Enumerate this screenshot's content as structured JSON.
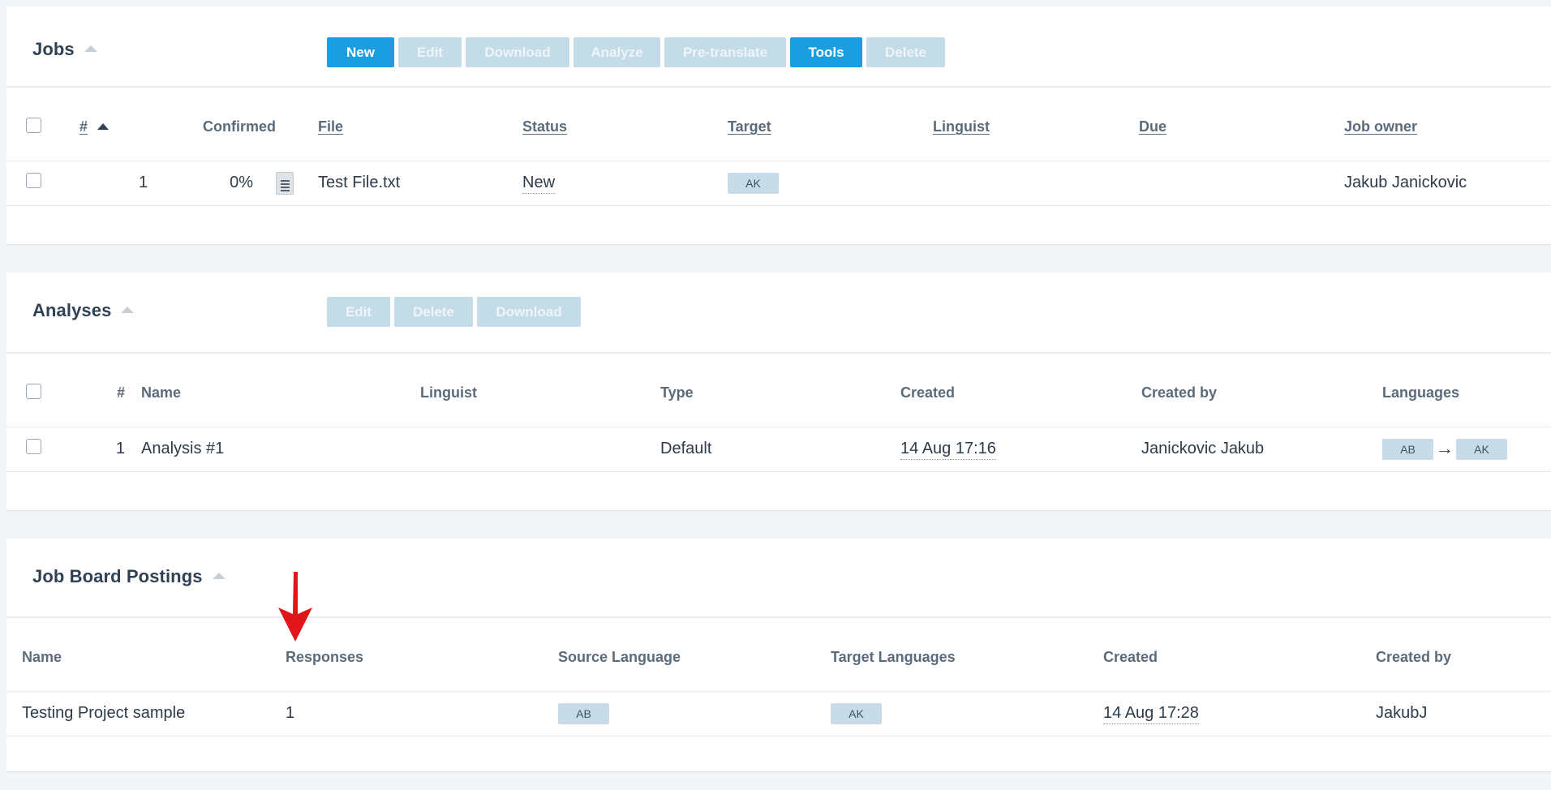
{
  "jobs": {
    "title": "Jobs",
    "toolbar": [
      {
        "label": "New",
        "state": "active"
      },
      {
        "label": "Edit",
        "state": "muted"
      },
      {
        "label": "Download",
        "state": "muted"
      },
      {
        "label": "Analyze",
        "state": "muted"
      },
      {
        "label": "Pre-translate",
        "state": "muted"
      },
      {
        "label": "Tools",
        "state": "active"
      },
      {
        "label": "Delete",
        "state": "muted"
      }
    ],
    "columns": {
      "num": "#",
      "confirmed": "Confirmed",
      "file": "File",
      "status": "Status",
      "target": "Target",
      "linguist": "Linguist",
      "due": "Due",
      "owner": "Job owner"
    },
    "rows": [
      {
        "num": "1",
        "confirmed": "0%",
        "file": "Test File.txt",
        "status": "New",
        "target": "AK",
        "linguist": "",
        "due": "",
        "owner": "Jakub Janickovic"
      }
    ]
  },
  "analyses": {
    "title": "Analyses",
    "toolbar": [
      {
        "label": "Edit",
        "state": "muted"
      },
      {
        "label": "Delete",
        "state": "muted"
      },
      {
        "label": "Download",
        "state": "muted"
      }
    ],
    "columns": {
      "num": "#",
      "name": "Name",
      "linguist": "Linguist",
      "type": "Type",
      "created": "Created",
      "created_by": "Created by",
      "languages": "Languages"
    },
    "rows": [
      {
        "num": "1",
        "name": "Analysis #1",
        "linguist": "",
        "type": "Default",
        "created": "14 Aug 17:16",
        "created_by": "Janickovic Jakub",
        "source_lang": "AB",
        "arrow": "→",
        "target_lang": "AK"
      }
    ]
  },
  "postings": {
    "title": "Job Board Postings",
    "columns": {
      "name": "Name",
      "responses": "Responses",
      "source_language": "Source Language",
      "target_languages": "Target Languages",
      "created": "Created",
      "created_by": "Created by"
    },
    "rows": [
      {
        "name": "Testing Project sample",
        "responses": "1",
        "source_language": "AB",
        "target_languages": "AK",
        "created": "14 Aug 17:28",
        "created_by": "JakubJ"
      }
    ]
  },
  "colors": {
    "active_button": "#1a9ee0",
    "muted_button": "#c4dbe8",
    "annotation_arrow": "#e0161b"
  }
}
